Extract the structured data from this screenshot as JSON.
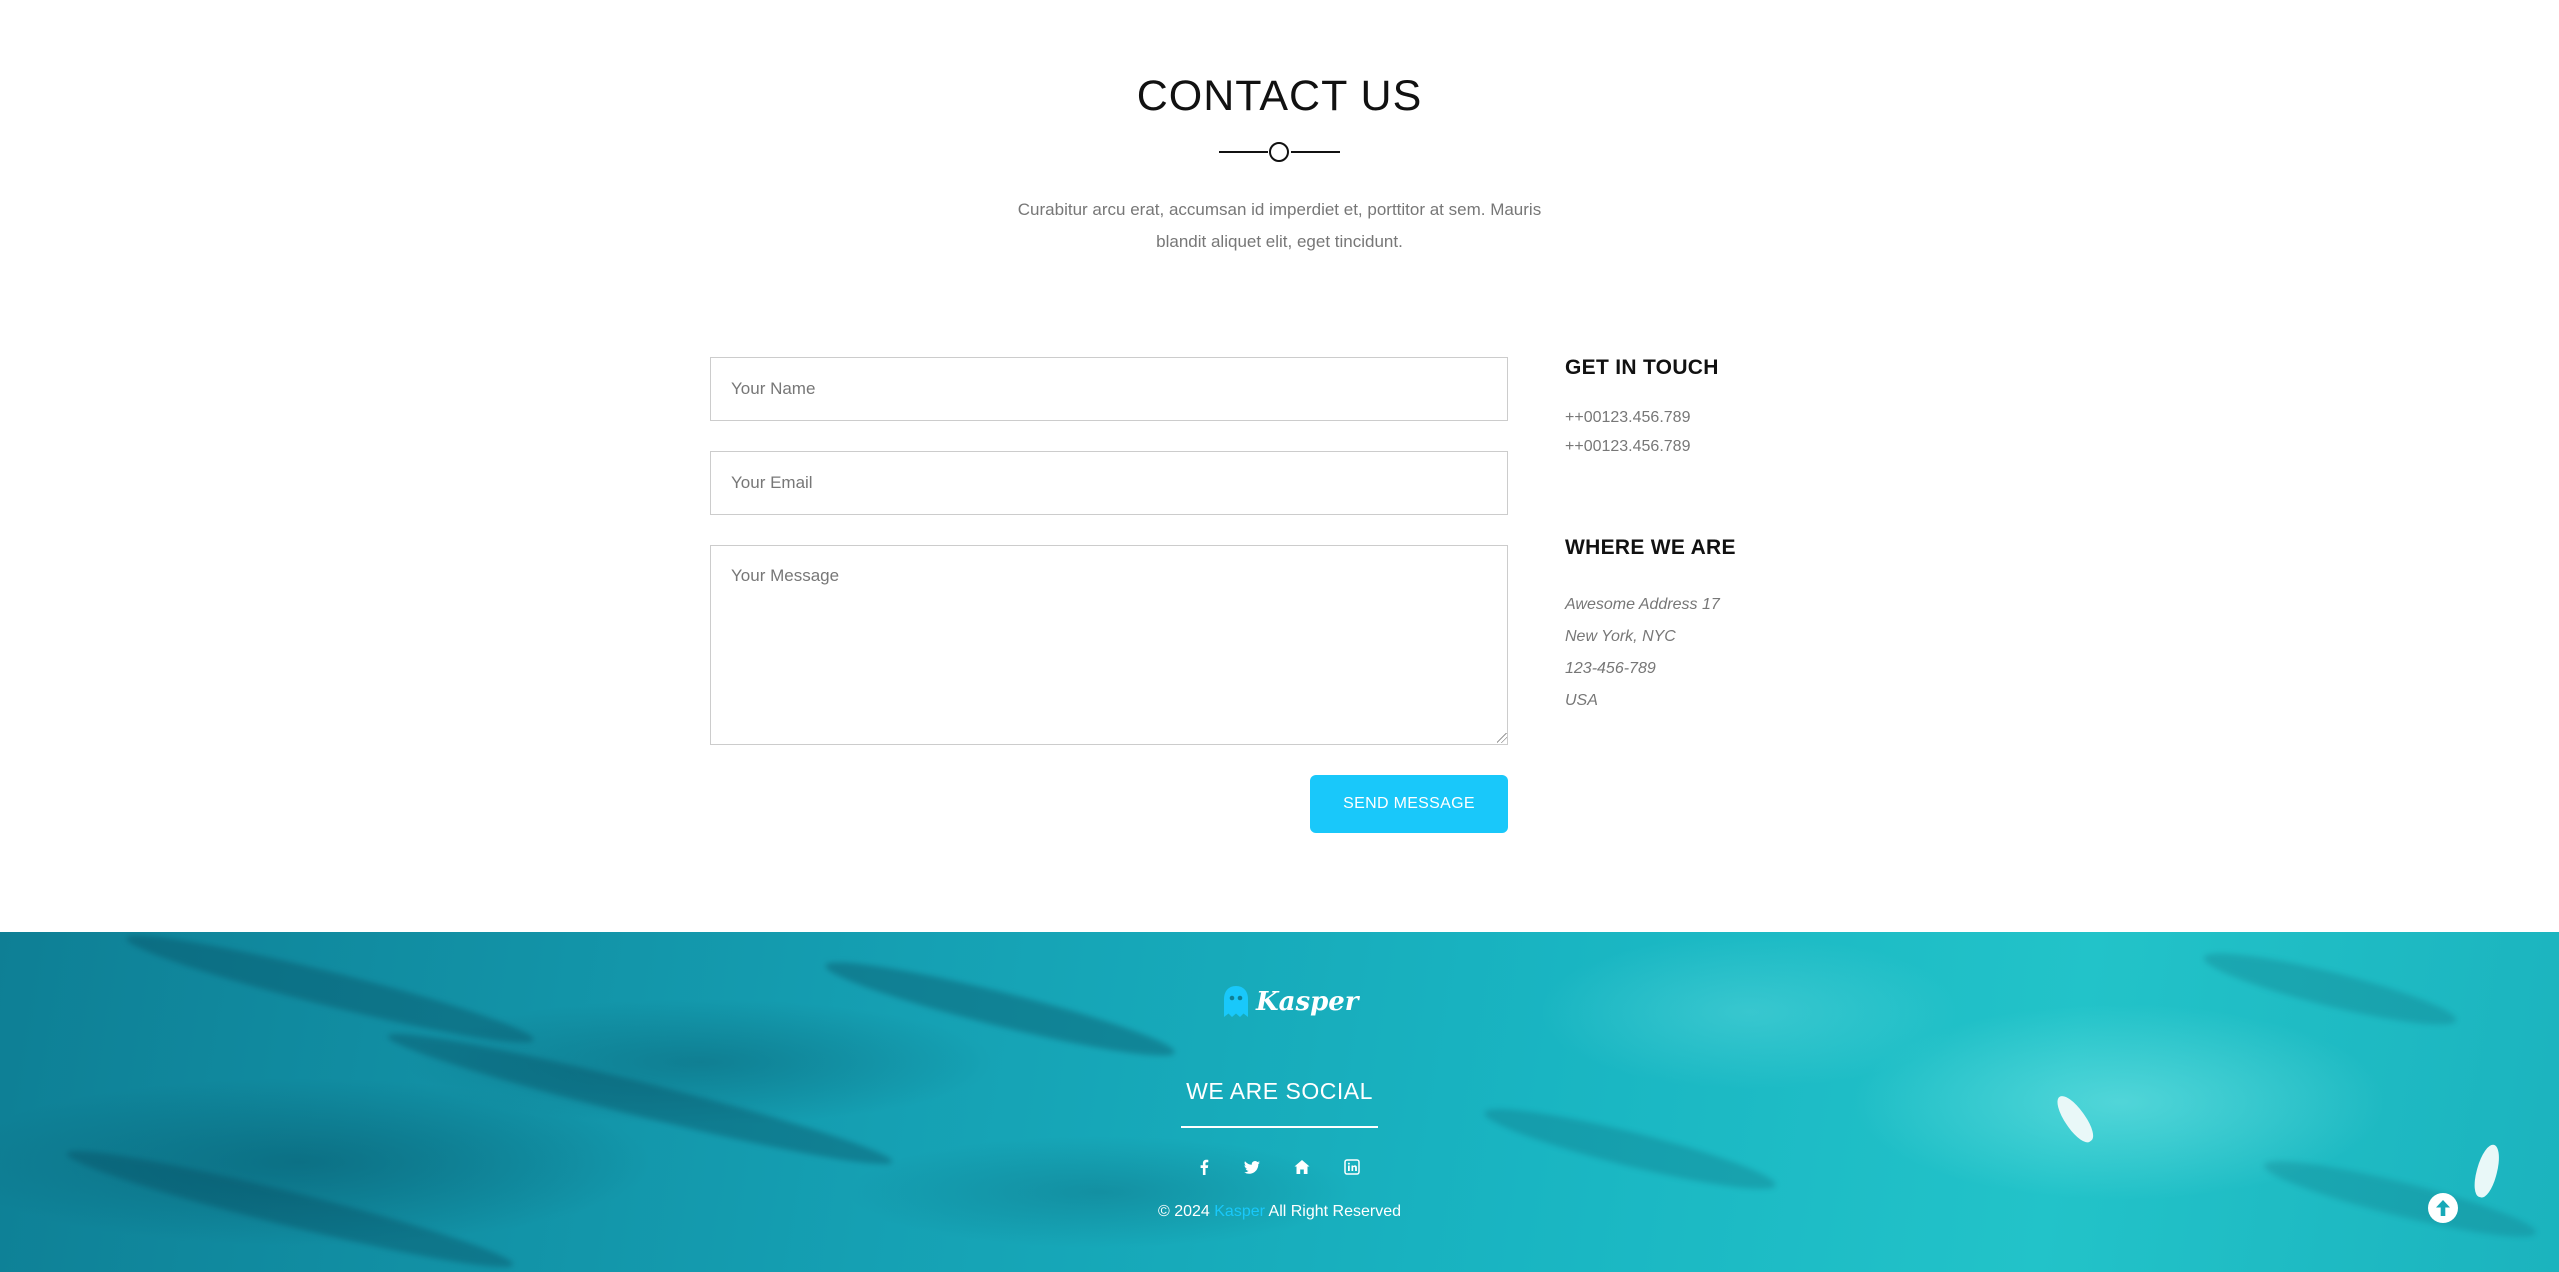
{
  "contact": {
    "title": "CONTACT US",
    "intro": "Curabitur arcu erat, accumsan id imperdiet et, porttitor at sem. Mauris blandit aliquet elit, eget tincidunt.",
    "form": {
      "name_placeholder": "Your Name",
      "email_placeholder": "Your Email",
      "message_placeholder": "Your Message",
      "send_label": "SEND MESSAGE"
    },
    "get_in_touch": {
      "heading": "GET IN TOUCH",
      "phones": [
        "++00123.456.789",
        "++00123.456.789"
      ]
    },
    "where_we_are": {
      "heading": "WHERE WE ARE",
      "lines": [
        "Awesome Address 17",
        "New York, NYC",
        "123-456-789",
        "USA"
      ]
    }
  },
  "footer": {
    "logo_text": "Kasper",
    "social_title": "WE ARE SOCIAL",
    "social_icons": [
      "facebook-icon",
      "twitter-icon",
      "home-icon",
      "linkedin-icon"
    ],
    "copyright_prefix": "© 2024 ",
    "copyright_brand": "Kasper",
    "copyright_suffix": " All Right Reserved"
  },
  "colors": {
    "accent": "#19c8fa",
    "heading": "#111111",
    "muted_text": "#777777",
    "footer_sea": "#17a9b8"
  }
}
